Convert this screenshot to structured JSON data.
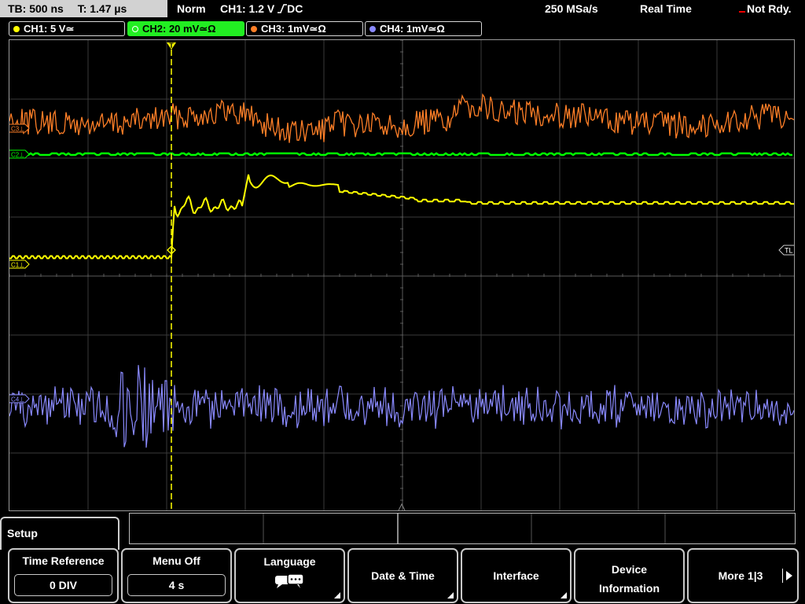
{
  "status": {
    "timebase": "TB: 500 ns",
    "trigger_time": "T: 1.47 µs",
    "trigger_mode": "Norm",
    "trigger_source": "CH1: 1.2 V",
    "trigger_slope_coupling": "DC",
    "sample_rate": "250 MSa/s",
    "acquisition_mode": "Real Time",
    "run_state": "Not Rdy."
  },
  "channels": [
    {
      "id": "CH1",
      "label": "CH1: 5 V",
      "suffix": "≃",
      "color": "#ffff00",
      "active": false,
      "marker": "C1"
    },
    {
      "id": "CH2",
      "label": "CH2: 20 mV",
      "suffix": "≃Ω",
      "color": "#00ff00",
      "active": true,
      "marker": "C2"
    },
    {
      "id": "CH3",
      "label": "CH3: 1mV",
      "suffix": "≃Ω",
      "color": "#ff7f27",
      "active": false,
      "marker": "C3"
    },
    {
      "id": "CH4",
      "label": "CH4: 1mV",
      "suffix": "≃Ω",
      "color": "#8a8aff",
      "active": false,
      "marker": "C4"
    }
  ],
  "markers": {
    "trigger_level": "TL",
    "trigger_position": "T"
  },
  "menu": {
    "title": "Setup",
    "softkeys": [
      {
        "label": "Time Reference",
        "value": "0 DIV"
      },
      {
        "label": "Menu Off",
        "value": "4 s"
      },
      {
        "label": "Language",
        "icon": "speech-bubble-icon"
      },
      {
        "label": "Date & Time"
      },
      {
        "label": "Interface"
      },
      {
        "label": "Device Information"
      },
      {
        "label": "More 1|3"
      }
    ]
  },
  "colors": {
    "grid": "#3a3a3a",
    "trigger_line": "#ffff00",
    "ch1": "#ffff00",
    "ch2": "#00ff00",
    "ch3": "#ff7f27",
    "ch4": "#8a8aff"
  }
}
